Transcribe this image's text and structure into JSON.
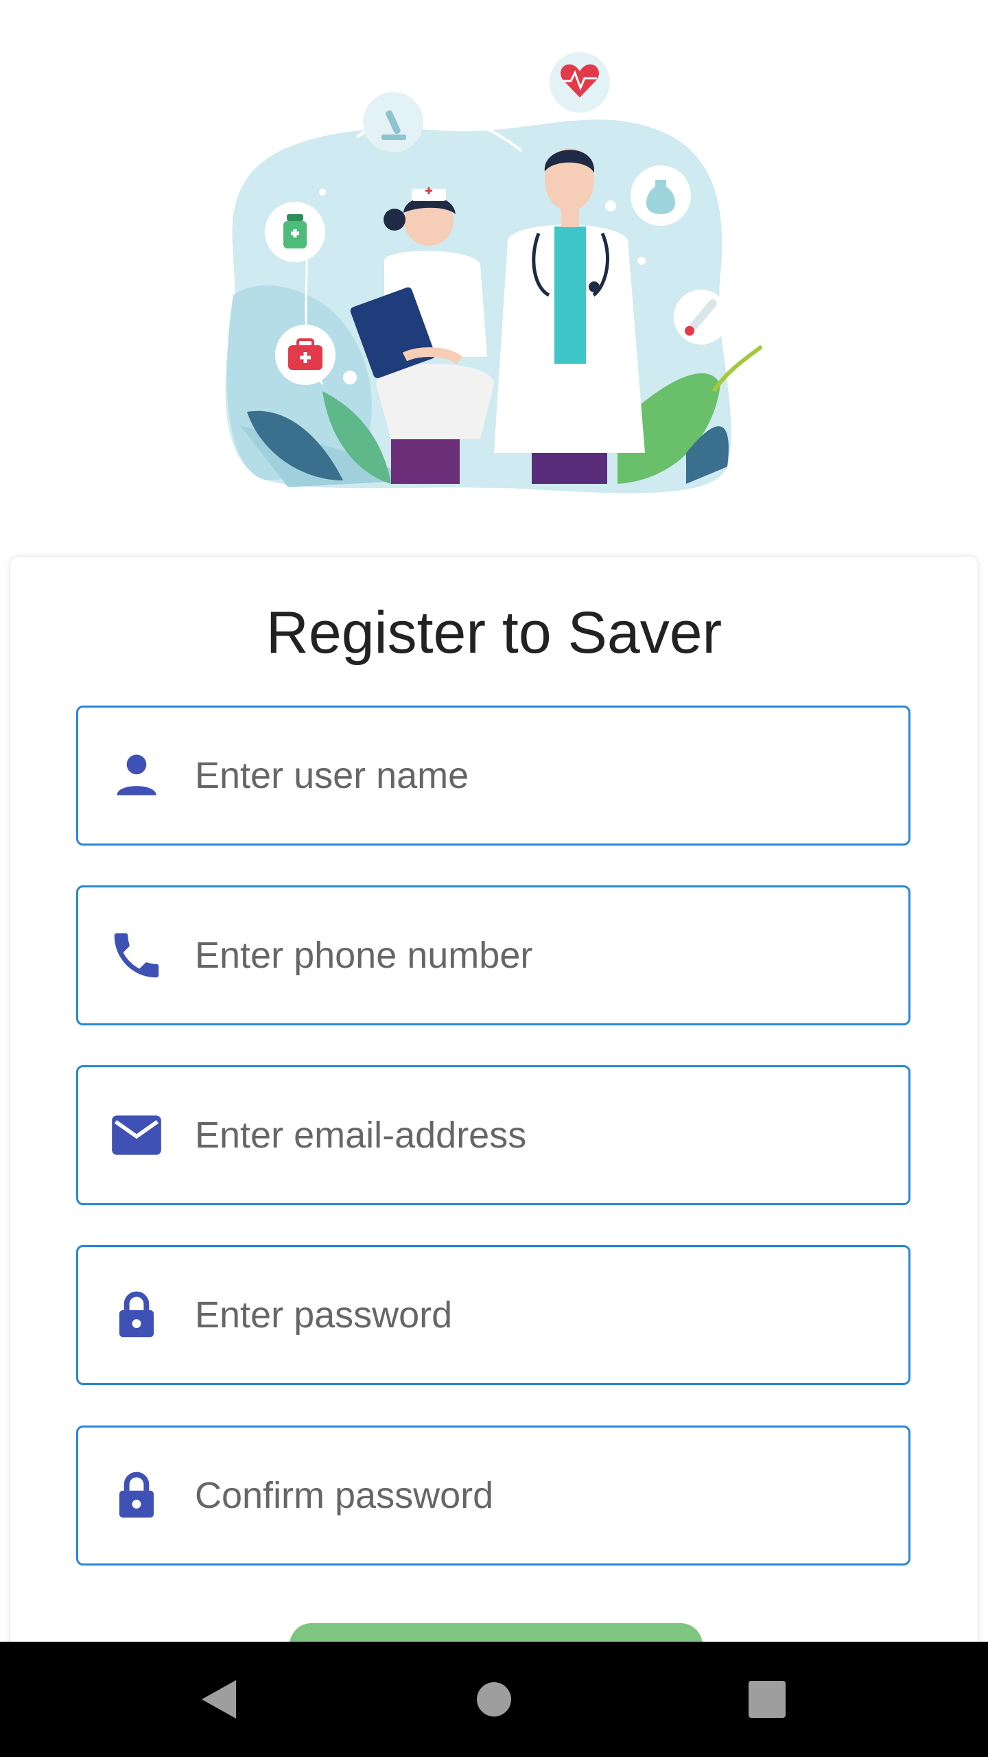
{
  "hero": {
    "icons": [
      "heart-pulse-icon",
      "microscope-icon",
      "medicine-bottle-icon",
      "pill-bottle-icon",
      "first-aid-kit-icon",
      "thermometer-icon"
    ]
  },
  "card": {
    "title": "Register to Saver",
    "fields": [
      {
        "icon": "person-icon",
        "placeholder": "Enter user name",
        "value": ""
      },
      {
        "icon": "phone-icon",
        "placeholder": "Enter phone number",
        "value": ""
      },
      {
        "icon": "mail-icon",
        "placeholder": "Enter email-address",
        "value": ""
      },
      {
        "icon": "lock-icon",
        "placeholder": "Enter password",
        "value": ""
      },
      {
        "icon": "lock-icon",
        "placeholder": "Confirm password",
        "value": ""
      }
    ]
  },
  "nav": {
    "back_icon": "back-triangle-icon",
    "home_icon": "home-circle-icon",
    "recents_icon": "recents-square-icon"
  },
  "colors": {
    "field_border": "#2587d9",
    "icon": "#3f51b5",
    "button": "#7ec57f",
    "navbar": "#000000"
  }
}
